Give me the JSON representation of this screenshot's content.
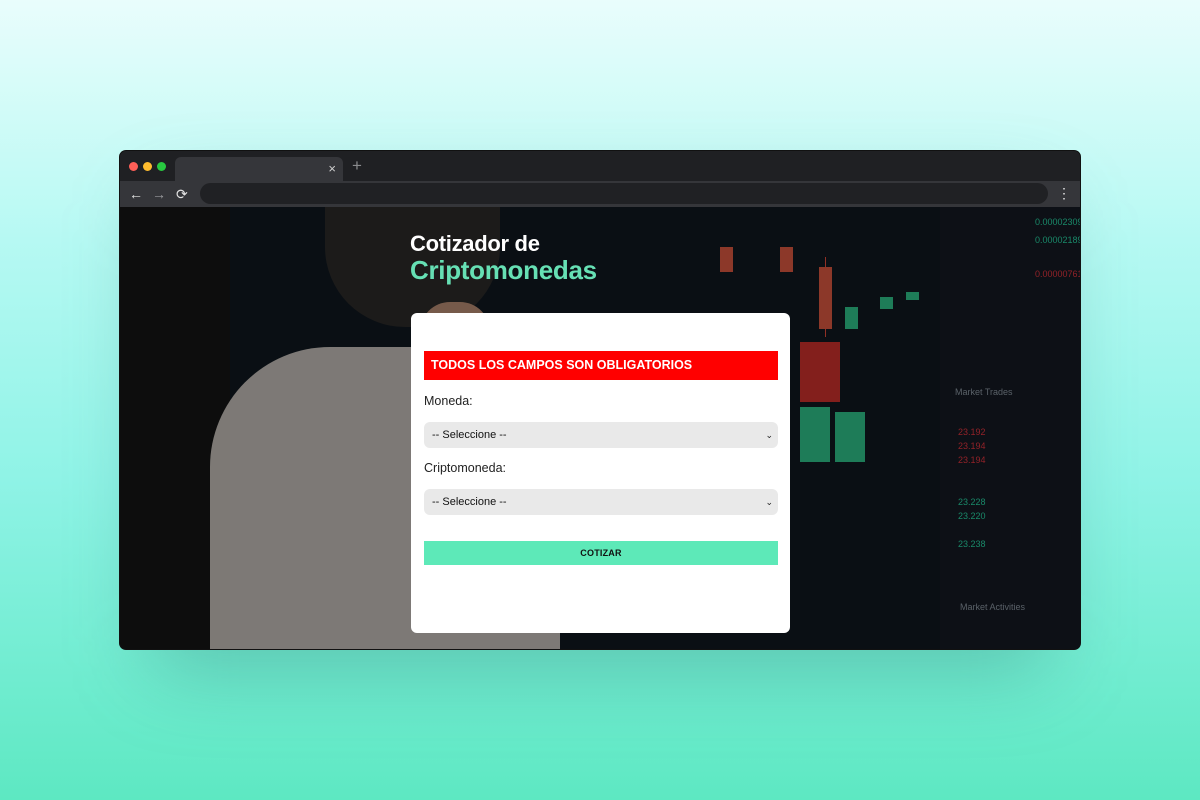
{
  "browser": {
    "tab_close": "×",
    "new_tab": "+",
    "back": "←",
    "forward": "→",
    "reload": "⟳",
    "menu": "⋮"
  },
  "heading": {
    "line1": "Cotizador de",
    "line2": "Criptomonedas"
  },
  "form": {
    "alert": "TODOS LOS CAMPOS SON OBLIGATORIOS",
    "currency_label": "Moneda:",
    "currency_value": "-- Seleccione --",
    "crypto_label": "Criptomoneda:",
    "crypto_value": "-- Seleccione --",
    "submit_label": "COTIZAR"
  },
  "colors": {
    "accent": "#66e0b4",
    "alert": "#ff0000",
    "button": "#5de9b8"
  }
}
